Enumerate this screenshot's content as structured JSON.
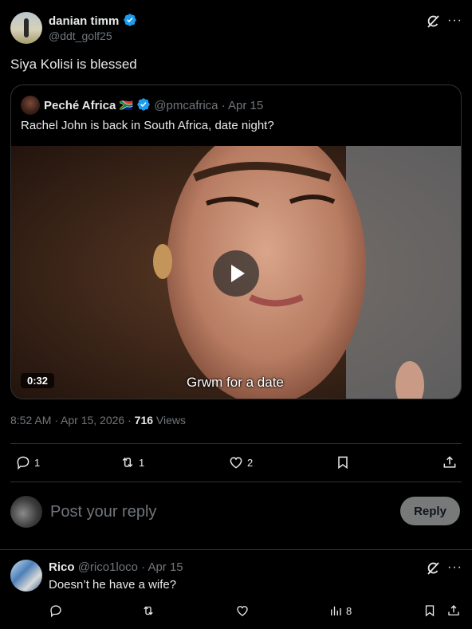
{
  "post": {
    "author_name": "danian timm",
    "author_handle": "@ddt_golf25",
    "text": "Siya Kolisi is blessed",
    "timestamp": "8:52 AM · Apr 15, 2026",
    "views_count": "716",
    "views_label": "Views",
    "replies": "1",
    "reposts": "1",
    "likes": "2"
  },
  "quote": {
    "author_name": "Peché Africa",
    "flag": "🇿🇦",
    "author_handle": "@pmcafrica",
    "date": "· Apr 15",
    "text": "Rachel John is back in South Africa, date night?",
    "video": {
      "duration": "0:32",
      "caption": "Grwm for a date"
    }
  },
  "reply_box": {
    "placeholder": "Post your reply",
    "button_label": "Reply"
  },
  "comment": {
    "author_name": "Rico",
    "author_handle": "@rico1loco",
    "date": "· Apr 15",
    "text": "Doesn’t he have a wife?",
    "views": "8"
  },
  "colors": {
    "accent": "#1d9bf0",
    "muted": "#71767b",
    "border": "#2f3336"
  }
}
